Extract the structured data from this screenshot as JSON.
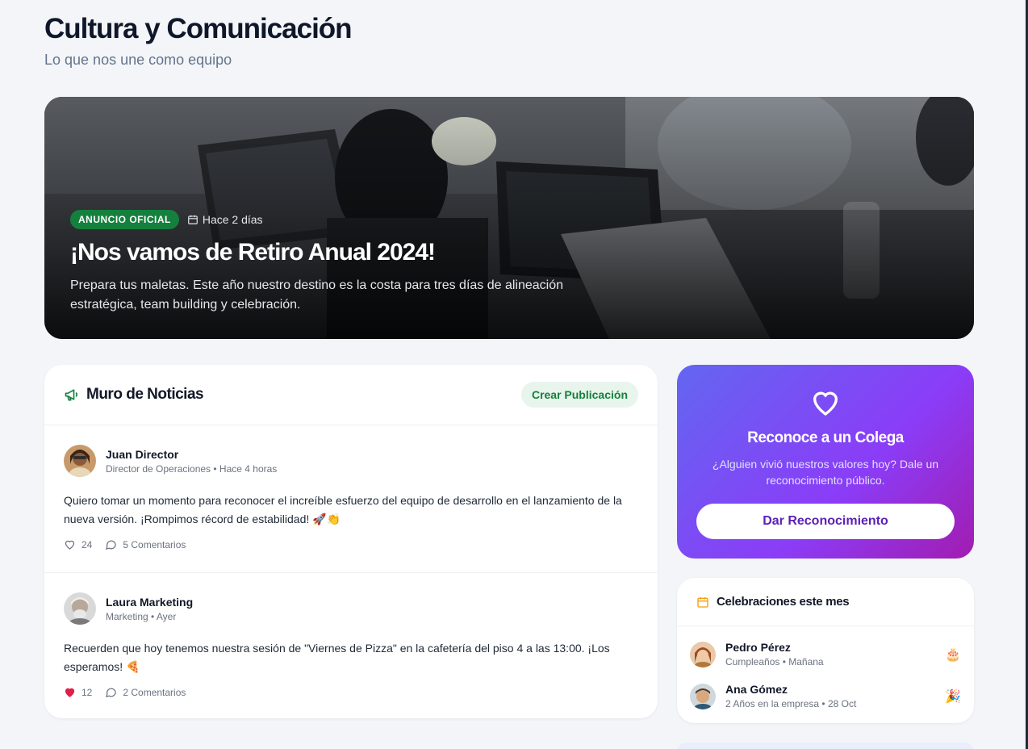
{
  "page": {
    "title": "Cultura y Comunicación",
    "subtitle": "Lo que nos une como equipo"
  },
  "hero": {
    "badge": "ANUNCIO OFICIAL",
    "date": "Hace 2 días",
    "title": "¡Nos vamos de Retiro Anual 2024!",
    "description": "Prepara tus maletas. Este año nuestro destino es la costa para tres días de alineación estratégica, team building y celebración."
  },
  "feed": {
    "title": "Muro de Noticias",
    "create_label": "Crear Publicación",
    "posts": [
      {
        "author": "Juan Director",
        "meta": "Director de Operaciones • Hace 4 horas",
        "body": "Quiero tomar un momento para reconocer el increíble esfuerzo del equipo de desarrollo en el lanzamiento de la nueva versión. ¡Rompimos récord de estabilidad! 🚀👏",
        "likes": "24",
        "comments": "5 Comentarios",
        "liked": false
      },
      {
        "author": "Laura Marketing",
        "meta": "Marketing • Ayer",
        "body": "Recuerden que hoy tenemos nuestra sesión de \"Viernes de Pizza\" en la cafetería del piso 4 a las 13:00. ¡Los esperamos! 🍕",
        "likes": "12",
        "comments": "2 Comentarios",
        "liked": true
      }
    ]
  },
  "recognition": {
    "title": "Reconoce a un Colega",
    "description": "¿Alguien vivió nuestros valores hoy? Dale un reconocimiento público.",
    "button": "Dar Reconocimiento"
  },
  "celebrations": {
    "title": "Celebraciones este mes",
    "items": [
      {
        "name": "Pedro Pérez",
        "detail": "Cumpleaños • Mañana",
        "emoji": "🎂"
      },
      {
        "name": "Ana Gómez",
        "detail": "2 Años en la empresa • 28 Oct",
        "emoji": "🎉"
      }
    ]
  },
  "colors": {
    "accent_green": "#15803d",
    "recognition_gradient": [
      "#6366f1",
      "#a21caf"
    ],
    "heart_liked": "#e11d48"
  }
}
